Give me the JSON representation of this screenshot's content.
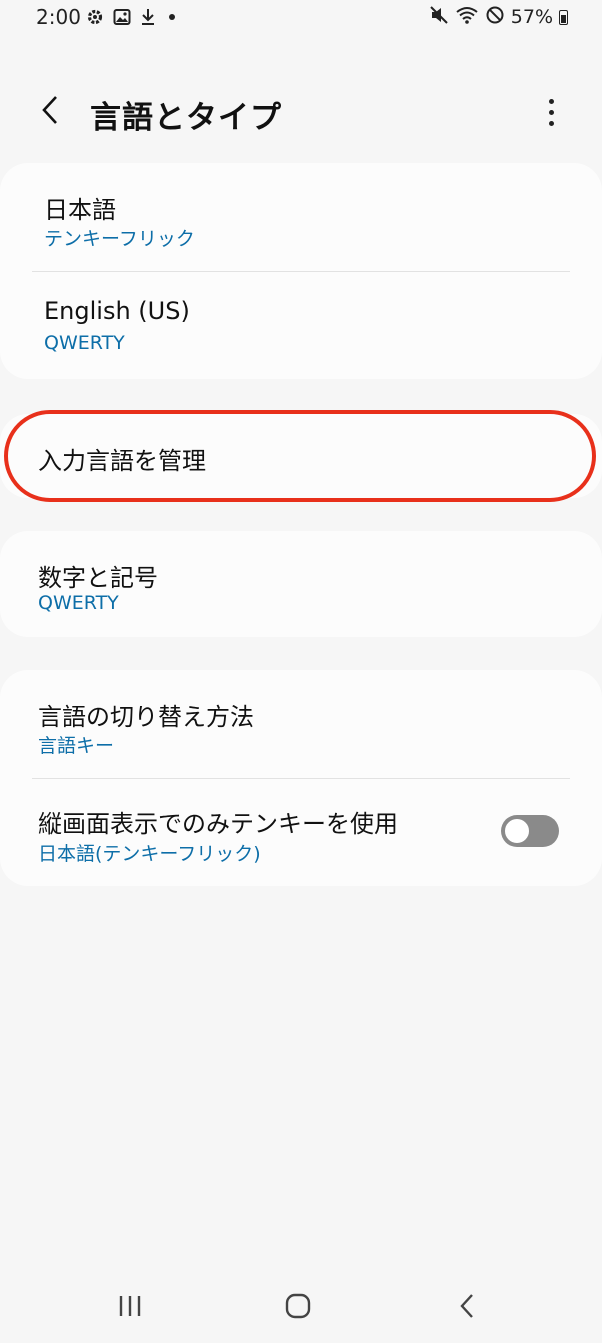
{
  "status_bar": {
    "time": "2:00",
    "battery_percent": "57%",
    "icons_left": [
      "gear-icon",
      "image-icon",
      "download-icon",
      "dot-icon"
    ],
    "icons_right": [
      "mute-icon",
      "wifi-icon",
      "do-not-disturb-icon",
      "battery-icon"
    ]
  },
  "header": {
    "title": "言語とタイプ"
  },
  "languages": [
    {
      "name": "日本語",
      "keyboard": "テンキーフリック"
    },
    {
      "name": "English (US)",
      "keyboard": "QWERTY"
    }
  ],
  "manage_languages": {
    "label": "入力言語を管理"
  },
  "symbols": {
    "label": "数字と記号",
    "value": "QWERTY"
  },
  "switching": {
    "method_label": "言語の切り替え方法",
    "method_value": "言語キー",
    "portrait_label": "縦画面表示でのみテンキーを使用",
    "portrait_value": "日本語(テンキーフリック)",
    "portrait_enabled": false
  },
  "colors": {
    "accent_blue": "#0d6ea8",
    "highlight_red": "#e8301b",
    "background": "#f6f6f6"
  }
}
